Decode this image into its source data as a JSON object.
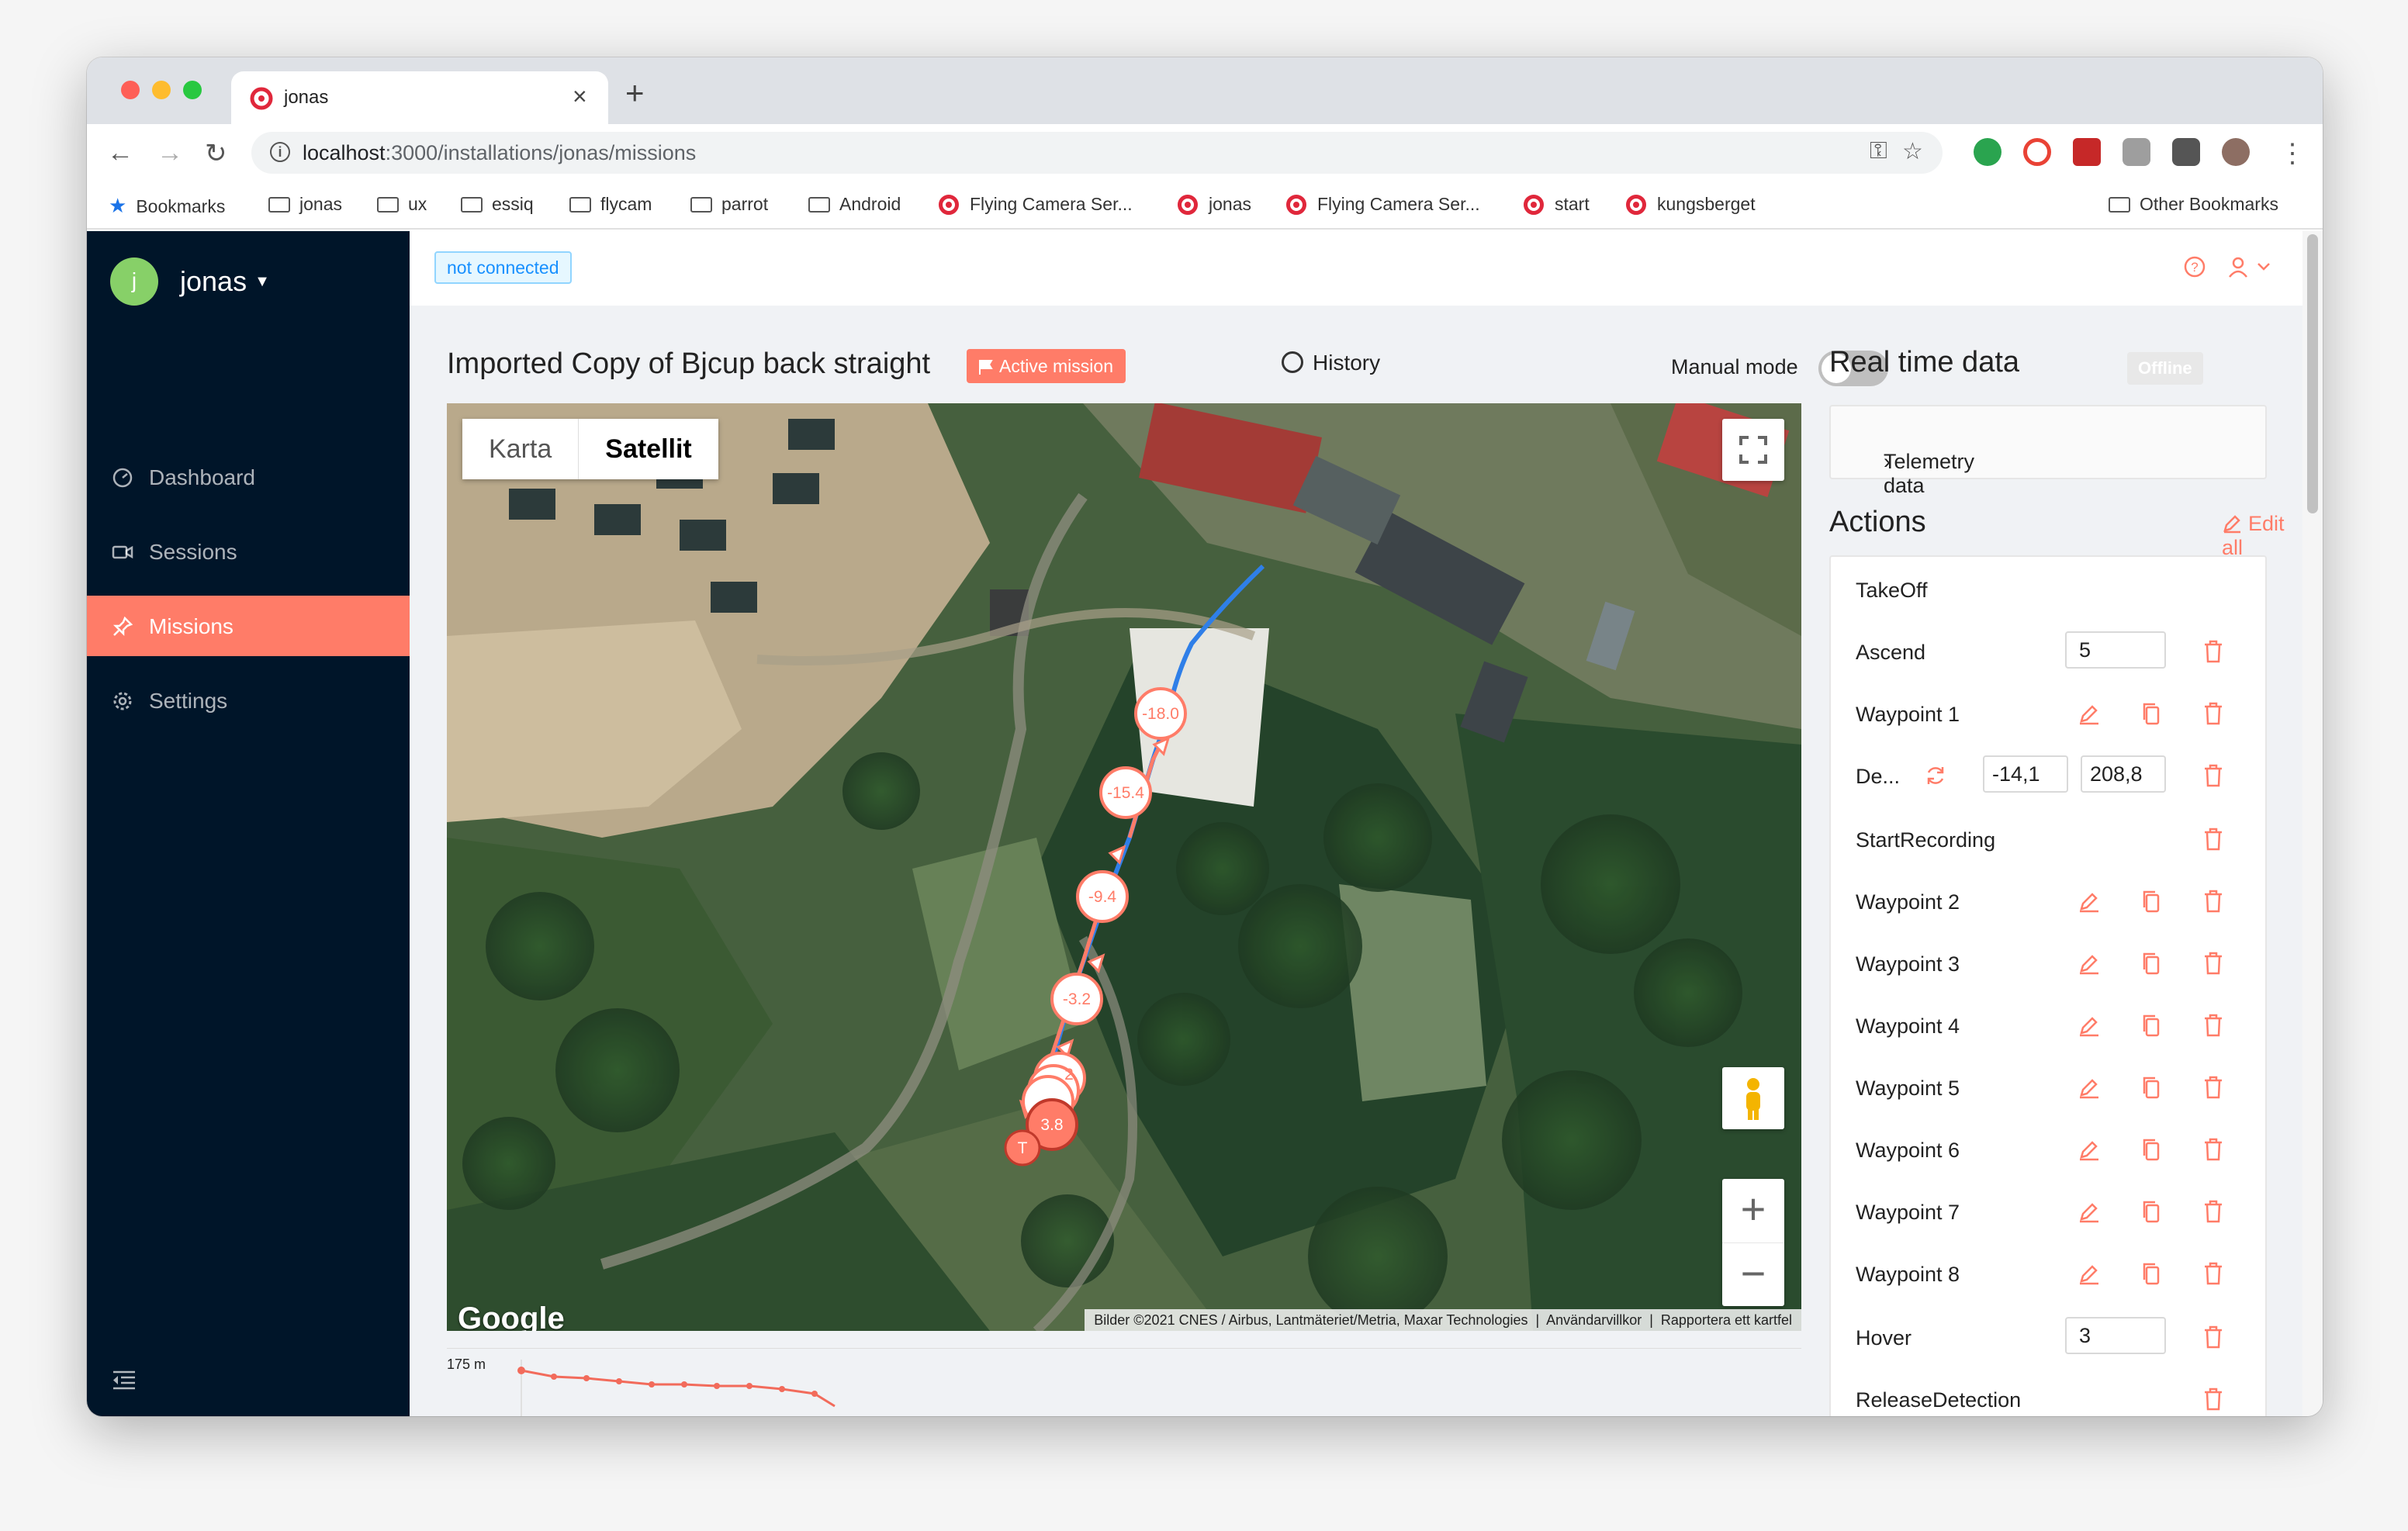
{
  "browser": {
    "tab_title": "jonas",
    "url_host": "localhost",
    "url_rest": ":3000/installations/jonas/missions",
    "bookmarks": [
      "Bookmarks",
      "jonas",
      "ux",
      "essiq",
      "flycam",
      "parrot",
      "Android",
      "Flying Camera Ser...",
      "jonas",
      "Flying Camera Ser...",
      "start",
      "kungsberget"
    ],
    "other_bookmarks": "Other Bookmarks"
  },
  "sidebar": {
    "avatar_letter": "j",
    "username": "jonas",
    "items": [
      {
        "label": "Dashboard",
        "icon": "dashboard-icon"
      },
      {
        "label": "Sessions",
        "icon": "video-camera-icon"
      },
      {
        "label": "Missions",
        "icon": "pushpin-icon",
        "active": true
      },
      {
        "label": "Settings",
        "icon": "gear-icon"
      }
    ]
  },
  "topbar": {
    "connection_status": "not connected"
  },
  "mission": {
    "title": "Imported Copy of Bjcup back straight",
    "active_label": "Active mission",
    "history_label": "History",
    "manual_mode_label": "Manual mode",
    "manual_mode_on": false
  },
  "map": {
    "type_options": [
      "Karta",
      "Satellit"
    ],
    "selected_type": "Satellit",
    "markers": [
      "-18.0",
      "-15.4",
      "-9.4",
      "-3.2",
      "2",
      "3.8",
      "T"
    ],
    "google_logo": "Google",
    "attribution": "Bilder ©2021 CNES / Airbus, Lantmäteriet/Metria, Maxar Technologies",
    "terms": "Användarvillkor",
    "report": "Rapportera ett kartfel"
  },
  "chart": {
    "ylabel": "175 m"
  },
  "realtime": {
    "title": "Real time data",
    "status": "Offline",
    "telemetry_label": "Telemetry data"
  },
  "actions": {
    "title": "Actions",
    "edit_all": "Edit all",
    "rows": [
      {
        "name": "TakeOff",
        "controls": []
      },
      {
        "name": "Ascend",
        "value": "5",
        "controls": [
          "delete"
        ]
      },
      {
        "name": "Waypoint 1",
        "controls": [
          "edit",
          "copy",
          "delete"
        ]
      },
      {
        "name": "De...",
        "value": "-14,1",
        "value2": "208,8",
        "controls": [
          "delete"
        ]
      },
      {
        "name": "StartRecording",
        "controls": [
          "delete"
        ]
      },
      {
        "name": "Waypoint 2",
        "controls": [
          "edit",
          "copy",
          "delete"
        ]
      },
      {
        "name": "Waypoint 3",
        "controls": [
          "edit",
          "copy",
          "delete"
        ]
      },
      {
        "name": "Waypoint 4",
        "controls": [
          "edit",
          "copy",
          "delete"
        ]
      },
      {
        "name": "Waypoint 5",
        "controls": [
          "edit",
          "copy",
          "delete"
        ]
      },
      {
        "name": "Waypoint 6",
        "controls": [
          "edit",
          "copy",
          "delete"
        ]
      },
      {
        "name": "Waypoint 7",
        "controls": [
          "edit",
          "copy",
          "delete"
        ]
      },
      {
        "name": "Waypoint 8",
        "controls": [
          "edit",
          "copy",
          "delete"
        ]
      },
      {
        "name": "Hover",
        "value": "3",
        "controls": [
          "delete"
        ]
      },
      {
        "name": "ReleaseDetection",
        "controls": [
          "delete"
        ]
      }
    ]
  },
  "colors": {
    "accent": "#ff7c68",
    "sidebar": "#001529",
    "path": "#2f7fe8"
  }
}
